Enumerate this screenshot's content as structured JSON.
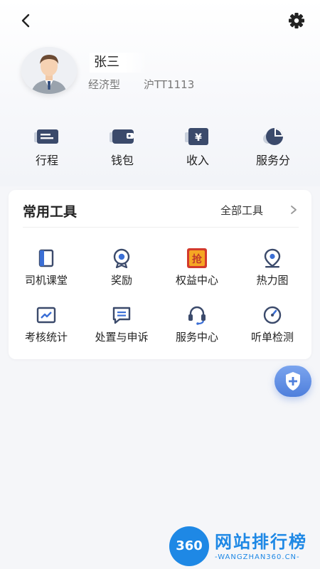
{
  "header": {
    "back_icon": "chevron-left-icon",
    "settings_icon": "gear-icon"
  },
  "profile": {
    "name": "张三",
    "car_type": "经济型",
    "plate": "沪TT1113"
  },
  "quick_actions": [
    {
      "label": "行程",
      "icon": "trip-card-icon"
    },
    {
      "label": "钱包",
      "icon": "wallet-icon"
    },
    {
      "label": "收入",
      "icon": "income-yuan-icon"
    },
    {
      "label": "服务分",
      "icon": "pie-chart-icon"
    }
  ],
  "tools": {
    "title": "常用工具",
    "all_label": "全部工具",
    "items": [
      {
        "label": "司机课堂",
        "icon": "book-icon"
      },
      {
        "label": "奖励",
        "icon": "medal-icon"
      },
      {
        "label": "权益中心",
        "icon": "grab-badge-icon",
        "badge_text": "抢"
      },
      {
        "label": "热力图",
        "icon": "map-pin-icon"
      },
      {
        "label": "考核统计",
        "icon": "stats-chart-icon"
      },
      {
        "label": "处置与申诉",
        "icon": "message-icon"
      },
      {
        "label": "服务中心",
        "icon": "headset-icon"
      },
      {
        "label": "听单检测",
        "icon": "speedometer-icon"
      }
    ]
  },
  "fab": {
    "icon": "shield-plus-icon"
  },
  "watermark": {
    "logo_text": "360",
    "title": "网站排行榜",
    "subtitle": "-WANGZHAN360.CN-"
  },
  "colors": {
    "icon_dark": "#3b4a6b",
    "accent_blue": "#4f7fdc",
    "grab_red": "#d33a2c",
    "grab_orange": "#f5a623"
  }
}
